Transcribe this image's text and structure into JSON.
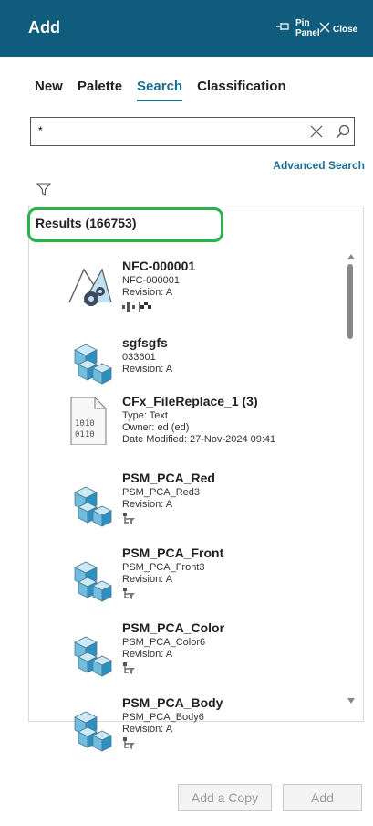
{
  "header": {
    "title": "Add",
    "pin_label_1": "Pin",
    "pin_label_2": "Panel",
    "close_label": "Close"
  },
  "tabs": [
    {
      "label": "New",
      "active": false
    },
    {
      "label": "Palette",
      "active": false
    },
    {
      "label": "Search",
      "active": true
    },
    {
      "label": "Classification",
      "active": false
    }
  ],
  "search": {
    "value": "*",
    "advanced_label": "Advanced Search"
  },
  "results": {
    "label": "Results (166753)",
    "items": [
      {
        "name": "NFC-000001",
        "line1": "NFC-000001",
        "line2": "Revision:  A",
        "icon": "nfc-assembly-icon",
        "status": [
          "structure-icon",
          "flag-icon"
        ]
      },
      {
        "name": "sgfsgfs",
        "line1": "033601",
        "line2": "Revision:  A",
        "icon": "part-cubes-icon",
        "status": []
      },
      {
        "name": "CFx_FileReplace_1 (3)",
        "line1": "Type:  Text",
        "line2": "Owner:  ed (ed)",
        "line3": "Date Modified:  27-Nov-2024 09:41",
        "icon": "text-file-icon",
        "status": []
      },
      {
        "name": "PSM_PCA_Red",
        "line1": "PSM_PCA_Red3",
        "line2": "Revision:  A",
        "icon": "part-cubes-icon",
        "status": [
          "structure-filter-icon"
        ]
      },
      {
        "name": "PSM_PCA_Front",
        "line1": "PSM_PCA_Front3",
        "line2": "Revision:  A",
        "icon": "part-cubes-icon",
        "status": [
          "structure-filter-icon"
        ]
      },
      {
        "name": "PSM_PCA_Color",
        "line1": "PSM_PCA_Color6",
        "line2": "Revision:  A",
        "icon": "part-cubes-icon",
        "status": [
          "structure-filter-icon"
        ]
      },
      {
        "name": "PSM_PCA_Body",
        "line1": "PSM_PCA_Body6",
        "line2": "Revision:  A",
        "icon": "part-cubes-icon",
        "status": [
          "structure-filter-icon"
        ]
      }
    ]
  },
  "footer": {
    "add_copy_label": "Add a Copy",
    "add_label": "Add"
  },
  "colors": {
    "header_bg": "#0f5c7c",
    "accent": "#1b6d8e",
    "highlight": "#2bb24c"
  }
}
